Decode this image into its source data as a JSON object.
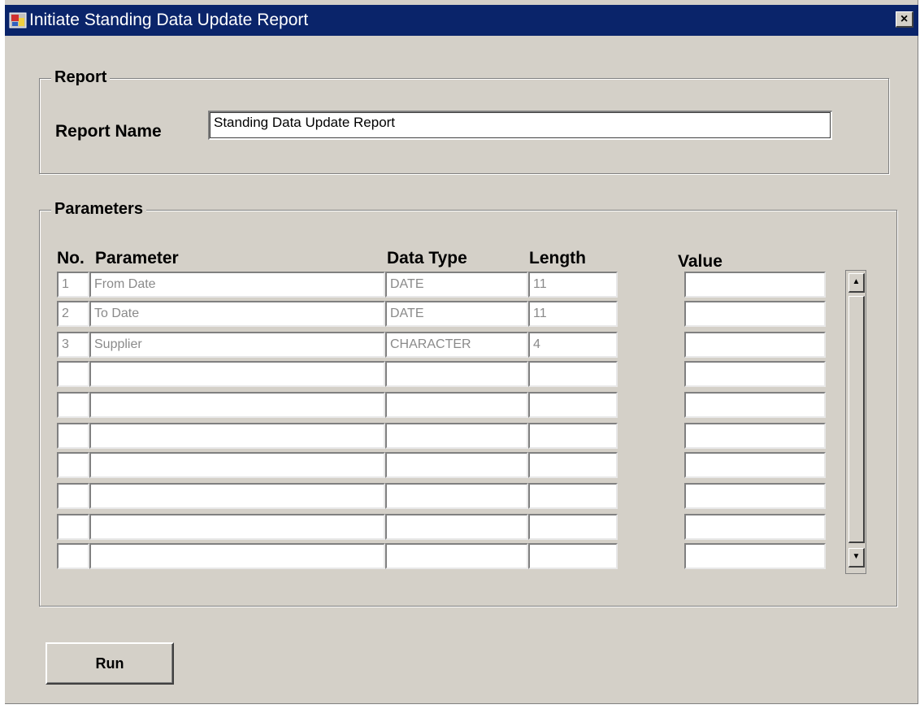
{
  "window": {
    "title": "Initiate Standing Data Update Report",
    "close_label": "×"
  },
  "report": {
    "group_label": "Report",
    "name_label": "Report Name",
    "name_value": "Standing Data Update Report"
  },
  "parameters": {
    "group_label": "Parameters",
    "headers": {
      "no": "No.",
      "parameter": "Parameter",
      "data_type": "Data Type",
      "length": "Length",
      "value": "Value"
    },
    "rows": [
      {
        "no": "1",
        "parameter": "From Date",
        "data_type": "DATE",
        "length": "11",
        "value": ""
      },
      {
        "no": "2",
        "parameter": "To Date",
        "data_type": "DATE",
        "length": "11",
        "value": ""
      },
      {
        "no": "3",
        "parameter": "Supplier",
        "data_type": "CHARACTER",
        "length": "4",
        "value": ""
      },
      {
        "no": "",
        "parameter": "",
        "data_type": "",
        "length": "",
        "value": ""
      },
      {
        "no": "",
        "parameter": "",
        "data_type": "",
        "length": "",
        "value": ""
      },
      {
        "no": "",
        "parameter": "",
        "data_type": "",
        "length": "",
        "value": ""
      },
      {
        "no": "",
        "parameter": "",
        "data_type": "",
        "length": "",
        "value": ""
      },
      {
        "no": "",
        "parameter": "",
        "data_type": "",
        "length": "",
        "value": ""
      },
      {
        "no": "",
        "parameter": "",
        "data_type": "",
        "length": "",
        "value": ""
      },
      {
        "no": "",
        "parameter": "",
        "data_type": "",
        "length": "",
        "value": ""
      }
    ],
    "scroll_up_label": "▲",
    "scroll_down_label": "▼"
  },
  "actions": {
    "run_label": "Run"
  },
  "icons": {
    "app": "app-window-icon",
    "close": "close-icon"
  },
  "colors": {
    "titlebar": "#0a246a",
    "window_bg": "#d4d0c8",
    "field_bg": "#ffffff",
    "readonly_text": "#8a8a8a"
  }
}
